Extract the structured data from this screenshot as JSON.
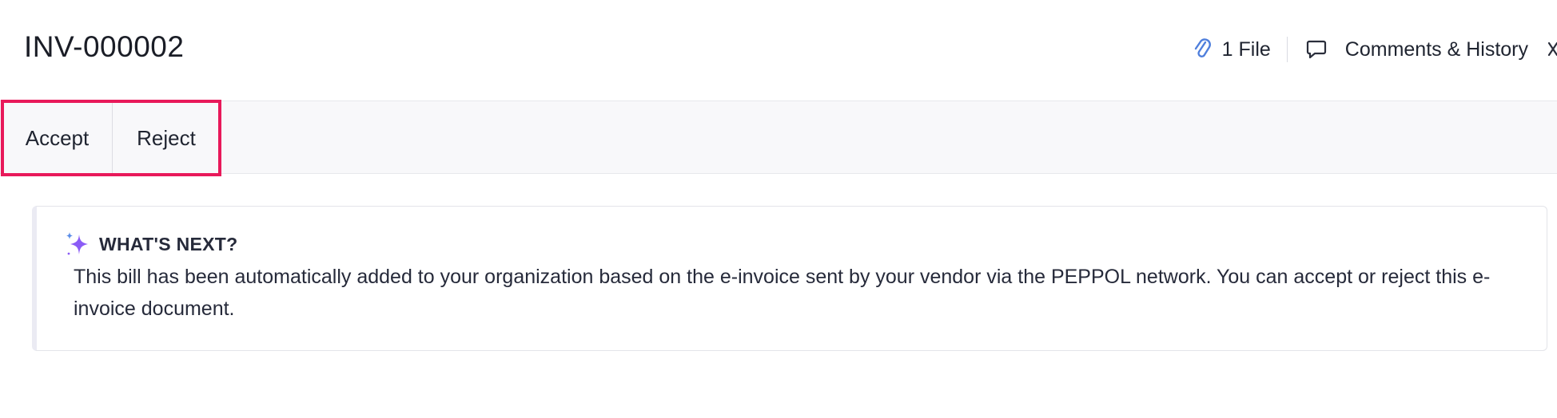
{
  "header": {
    "title": "INV-000002",
    "files_label": "1 File",
    "comments_label": "Comments & History"
  },
  "actions": {
    "accept_label": "Accept",
    "reject_label": "Reject"
  },
  "notice": {
    "title": "WHAT'S NEXT?",
    "body": "This bill has been automatically added to your organization based on the e-invoice sent by your vendor via the PEPPOL network. You can accept or reject this e-invoice document."
  },
  "icons": {
    "attachment": "paperclip-icon",
    "comments": "speech-bubble-icon",
    "close": "close-icon",
    "sparkle": "sparkle-icon"
  },
  "colors": {
    "highlight": "#e8195a",
    "attachment_icon": "#4f7fdc",
    "sparkle": "#8b5cf6"
  }
}
